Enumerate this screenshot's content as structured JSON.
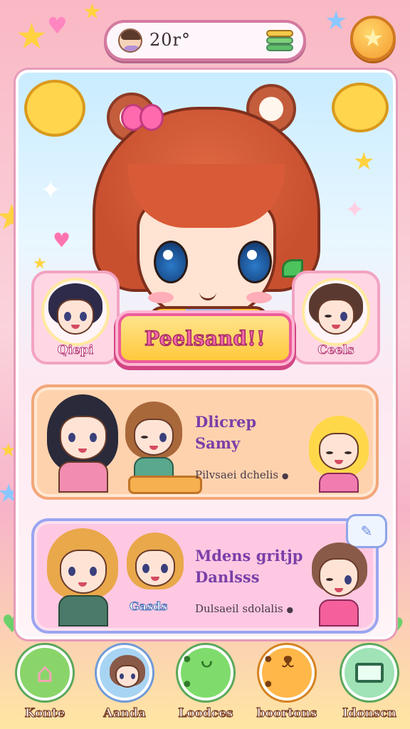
{
  "top_bar": {
    "score": "20r°",
    "avatar_icon": "player-avatar",
    "currency_icon": "coin-stack-icon",
    "favorite_icon": "star-icon"
  },
  "hero": {
    "title": "Peelsand!!"
  },
  "side_profiles": [
    {
      "label": "Qiepi"
    },
    {
      "label": "Ceels"
    }
  ],
  "list_cards": [
    {
      "title_line1": "Dlicrep",
      "title_line2": "Samy",
      "subtitle": "Pilvsaei dchelis",
      "indicator": "●"
    },
    {
      "title_line1": "Mdens gritjp",
      "title_line2": "Danlsss",
      "subtitle": "Dulsaeil sdolalis",
      "indicator": "●",
      "badge": "Gasds"
    }
  ],
  "bottom_nav": [
    {
      "label": "Konte",
      "icon": "home-icon",
      "color": "#8ad56a"
    },
    {
      "label": "Aanda",
      "icon": "friend-avatar-icon",
      "color": "#a8d4f3"
    },
    {
      "label": "Loodces",
      "icon": "frog-icon",
      "color": "#7fdc6c"
    },
    {
      "label": "boortons",
      "icon": "bear-icon",
      "color": "#ffb74a"
    },
    {
      "label": "Idonscn",
      "icon": "computer-icon",
      "color": "#9fe3b6"
    }
  ],
  "colors": {
    "accent_pink": "#ec5d9a",
    "accent_yellow": "#ffc93c",
    "title_purple": "#7a3fa8"
  }
}
